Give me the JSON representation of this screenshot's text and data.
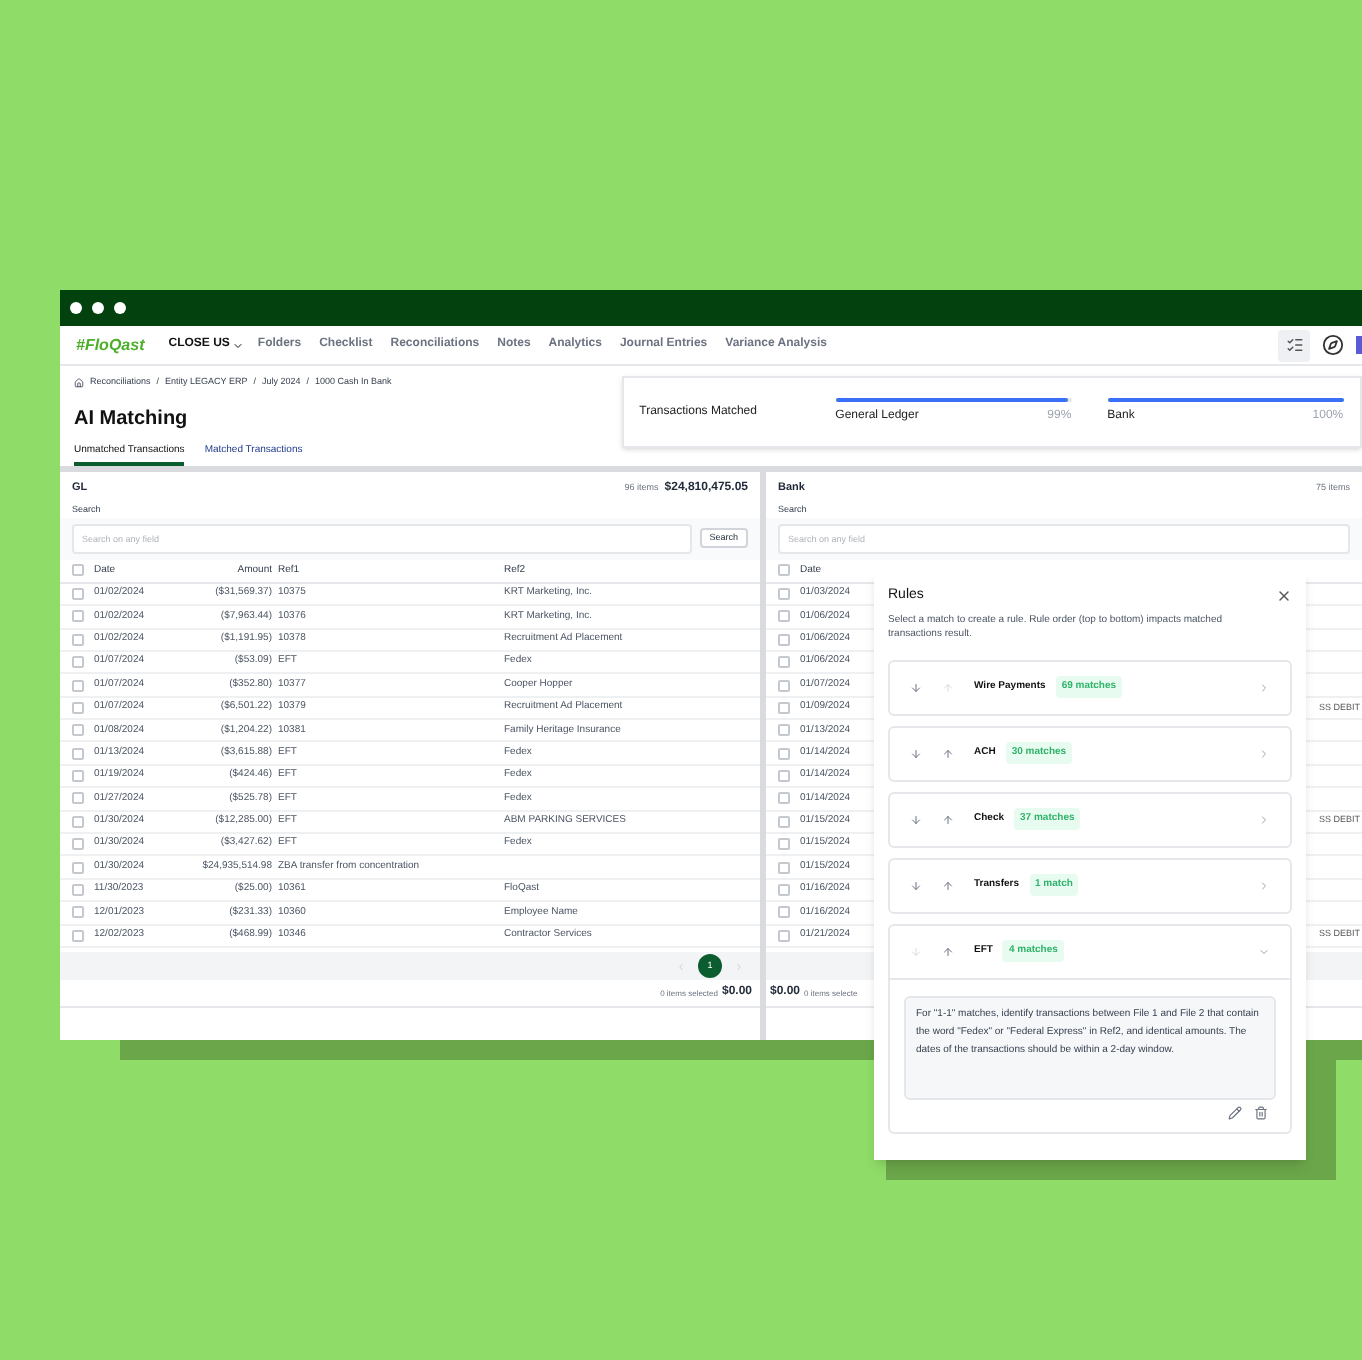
{
  "window": {
    "logo": "#FloQast",
    "nav": [
      {
        "label": "CLOSE US",
        "kind": "menu"
      },
      {
        "label": "Folders",
        "kind": "link"
      },
      {
        "label": "Checklist",
        "kind": "link"
      },
      {
        "label": "Reconciliations",
        "kind": "link"
      },
      {
        "label": "Notes",
        "kind": "link"
      },
      {
        "label": "Analytics",
        "kind": "link"
      },
      {
        "label": "Journal Entries",
        "kind": "link"
      },
      {
        "label": "Variance Analysis",
        "kind": "link"
      }
    ]
  },
  "breadcrumb": {
    "separator": "/",
    "items": [
      "Reconciliations",
      "Entity LEGACY ERP",
      "July 2024",
      "1000 Cash In Bank"
    ]
  },
  "title": "AI Matching",
  "tabs": [
    {
      "label": "Unmatched Transactions",
      "selected": true
    },
    {
      "label": "Matched Transactions",
      "selected": false
    }
  ],
  "matched_card": {
    "title": "Transactions Matched",
    "meters": [
      {
        "label": "General Ledger",
        "reading": "99%",
        "level": 0.99
      },
      {
        "label": "Bank",
        "reading": "100%",
        "level": 1
      }
    ]
  },
  "gl": {
    "title": "GL",
    "count": "96 items",
    "total": "$24,810,475.05",
    "search_label": "Search",
    "placeholder": "Search on any field",
    "search_button": "Search",
    "columns": [
      "Date",
      "Amount",
      "Ref1",
      "Ref2"
    ],
    "header_checked": false,
    "rows": [
      {
        "checked": false,
        "cells": [
          "01/02/2024",
          "($31,569.37)",
          "10375",
          "KRT Marketing, Inc."
        ]
      },
      {
        "checked": false,
        "cells": [
          "01/02/2024",
          "($7,963.44)",
          "10376",
          "KRT Marketing, Inc."
        ]
      },
      {
        "checked": false,
        "cells": [
          "01/02/2024",
          "($1,191.95)",
          "10378",
          "Recruitment Ad Placement"
        ]
      },
      {
        "checked": false,
        "cells": [
          "01/07/2024",
          "($53.09)",
          "EFT",
          "Fedex"
        ]
      },
      {
        "checked": false,
        "cells": [
          "01/07/2024",
          "($352.80)",
          "10377",
          "Cooper Hopper"
        ]
      },
      {
        "checked": false,
        "cells": [
          "01/07/2024",
          "($6,501.22)",
          "10379",
          "Recruitment Ad Placement"
        ]
      },
      {
        "checked": false,
        "cells": [
          "01/08/2024",
          "($1,204.22)",
          "10381",
          "Family Heritage Insurance"
        ]
      },
      {
        "checked": false,
        "cells": [
          "01/13/2024",
          "($3,615.88)",
          "EFT",
          "Fedex"
        ]
      },
      {
        "checked": false,
        "cells": [
          "01/19/2024",
          "($424.46)",
          "EFT",
          "Fedex"
        ]
      },
      {
        "checked": false,
        "cells": [
          "01/27/2024",
          "($525.78)",
          "EFT",
          "Fedex"
        ]
      },
      {
        "checked": false,
        "cells": [
          "01/30/2024",
          "($12,285.00)",
          "EFT",
          "ABM PARKING SERVICES"
        ]
      },
      {
        "checked": false,
        "cells": [
          "01/30/2024",
          "($3,427.62)",
          "EFT",
          "Fedex"
        ]
      },
      {
        "checked": false,
        "cells": [
          "01/30/2024",
          "$24,935,514.98",
          "ZBA transfer from concentration",
          ""
        ]
      },
      {
        "checked": false,
        "cells": [
          "11/30/2023",
          "($25.00)",
          "10361",
          "FloQast"
        ]
      },
      {
        "checked": false,
        "cells": [
          "12/01/2023",
          "($231.33)",
          "10360",
          "Employee Name"
        ]
      },
      {
        "checked": false,
        "cells": [
          "12/02/2023",
          "($468.99)",
          "10346",
          "Contractor Services"
        ]
      }
    ],
    "pages": [
      {
        "label": "1",
        "selected": true
      }
    ],
    "selected_count": "0 items selected",
    "selected_total": "$0.00"
  },
  "bank": {
    "title": "Bank",
    "count": "75 items",
    "search_label": "Search",
    "placeholder": "Search on any field",
    "columns": [
      "Date"
    ],
    "header_checked": false,
    "rows": [
      {
        "checked": false,
        "date": "01/03/2024"
      },
      {
        "checked": false,
        "date": "01/06/2024"
      },
      {
        "checked": false,
        "date": "01/06/2024"
      },
      {
        "checked": false,
        "date": "01/06/2024"
      },
      {
        "checked": false,
        "date": "01/07/2024"
      },
      {
        "checked": false,
        "date": "01/09/2024",
        "column_3": "SS DEBIT"
      },
      {
        "checked": false,
        "date": "01/13/2024"
      },
      {
        "checked": false,
        "date": "01/14/2024"
      },
      {
        "checked": false,
        "date": "01/14/2024"
      },
      {
        "checked": false,
        "date": "01/14/2024"
      },
      {
        "checked": false,
        "date": "01/15/2024",
        "column_3": "SS DEBIT"
      },
      {
        "checked": false,
        "date": "01/15/2024"
      },
      {
        "checked": false,
        "date": "01/15/2024"
      },
      {
        "checked": false,
        "date": "01/16/2024"
      },
      {
        "checked": false,
        "date": "01/16/2024"
      },
      {
        "checked": false,
        "date": "01/21/2024",
        "column_3": "SS DEBIT"
      }
    ],
    "selected_total": "$0.00",
    "selected_count": "0 items selecte"
  },
  "rules_panel": {
    "title": "Rules",
    "description": "Select a match to create a rule. Rule order (top to bottom) impacts matched transactions result.",
    "rules": [
      {
        "name": "Wire Payments",
        "matches": "69 matches",
        "up_disabled": true,
        "down_disabled": false,
        "expanded": false
      },
      {
        "name": "ACH",
        "matches": "30 matches",
        "up_disabled": false,
        "down_disabled": false,
        "expanded": false
      },
      {
        "name": "Check",
        "matches": "37 matches",
        "up_disabled": false,
        "down_disabled": false,
        "expanded": false
      },
      {
        "name": "Transfers",
        "matches": "1 match",
        "up_disabled": false,
        "down_disabled": false,
        "expanded": false
      },
      {
        "name": "EFT",
        "matches": "4 matches",
        "up_disabled": false,
        "down_disabled": true,
        "expanded": true,
        "prompt": "For \"1-1\" matches, identify transactions between File 1 and File 2 that contain the word \"Fedex\" or \"Federal Express\" in Ref2, and identical amounts. The dates of the transactions should be within a 2-day window."
      }
    ]
  }
}
